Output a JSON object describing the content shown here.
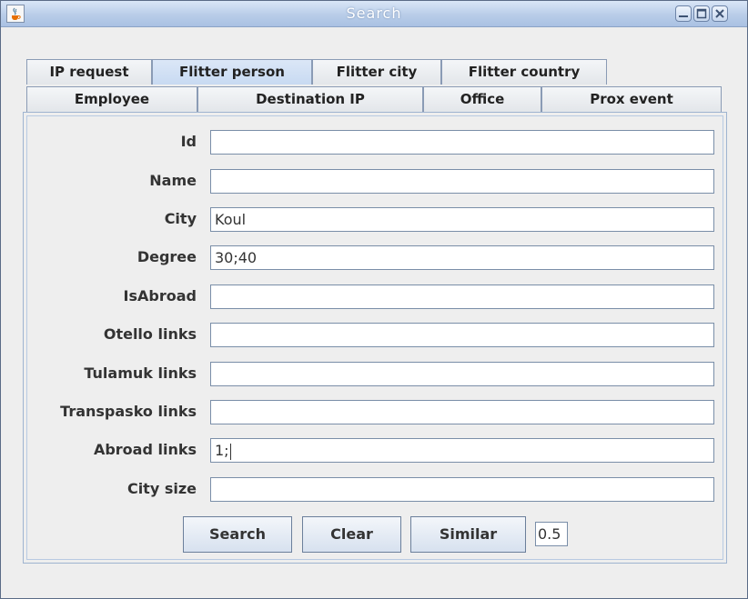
{
  "window": {
    "title": "Search",
    "title_color": "#ffffff",
    "titlebar_color": "#b9cde8"
  },
  "tabs": {
    "row1": [
      {
        "label": "IP request",
        "selected": false
      },
      {
        "label": "Flitter person",
        "selected": true
      },
      {
        "label": "Flitter city",
        "selected": false
      },
      {
        "label": "Flitter country",
        "selected": false
      }
    ],
    "row2": [
      {
        "label": "Employee",
        "selected": false
      },
      {
        "label": "Destination IP",
        "selected": false
      },
      {
        "label": "Office",
        "selected": false
      },
      {
        "label": "Prox event",
        "selected": false
      }
    ]
  },
  "form": {
    "fields": [
      {
        "label": "Id",
        "value": ""
      },
      {
        "label": "Name",
        "value": ""
      },
      {
        "label": "City",
        "value": "Koul"
      },
      {
        "label": "Degree",
        "value": "30;40"
      },
      {
        "label": "IsAbroad",
        "value": ""
      },
      {
        "label": "Otello links",
        "value": ""
      },
      {
        "label": "Tulamuk links",
        "value": ""
      },
      {
        "label": "Transpasko links",
        "value": ""
      },
      {
        "label": "Abroad links",
        "value": "1;"
      },
      {
        "label": "City size",
        "value": ""
      }
    ]
  },
  "buttons": {
    "search_label": "Search",
    "clear_label": "Clear",
    "similar_label": "Similar",
    "threshold_value": "0.5"
  },
  "icons": {
    "app": "java-cup-icon",
    "minimize": "minimize-icon",
    "maximize": "maximize-icon",
    "close": "close-icon"
  }
}
